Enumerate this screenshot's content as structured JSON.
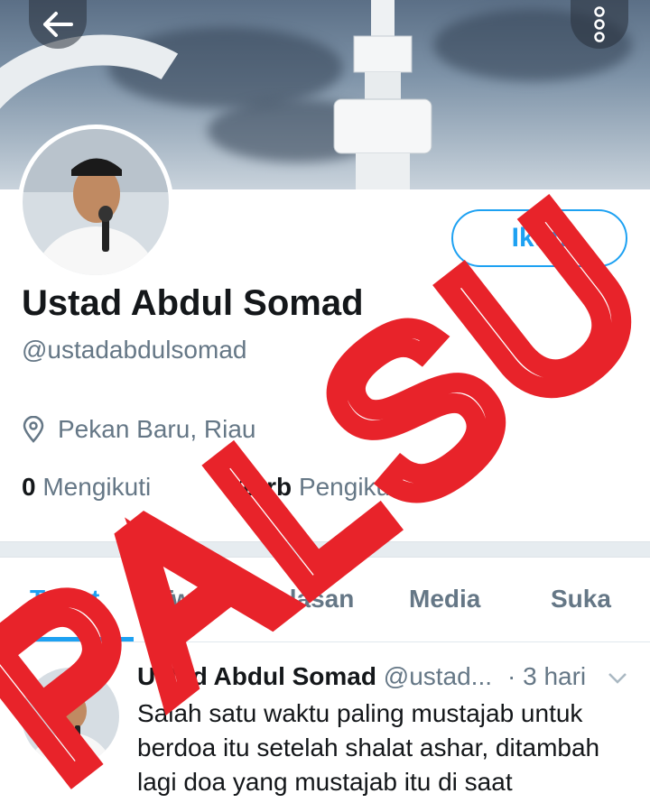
{
  "header": {
    "back_icon": "arrow-left-icon",
    "more_icon": "vertical-dots-icon"
  },
  "profile": {
    "follow_label": "Ikuti",
    "name": "Ustad Abdul Somad",
    "handle": "@ustadabdulsomad",
    "location_icon": "map-pin-icon",
    "location": "Pekan Baru, Riau",
    "following_count": "0",
    "following_label": "Mengikuti",
    "followers_count": "10rb",
    "followers_label": "Pengikut"
  },
  "tabs": [
    {
      "label": "Tweet",
      "active": true
    },
    {
      "label": "Tweet & balasan",
      "active": false
    },
    {
      "label": "Media",
      "active": false
    },
    {
      "label": "Suka",
      "active": false
    }
  ],
  "tweet": {
    "author": "Ustad Abdul Somad",
    "handle": "@ustad...",
    "time": "· 3 hari",
    "lines": [
      "Salah satu waktu paling mustajab untuk",
      "berdoa itu setelah shalat ashar, ditambah",
      "lagi doa yang mustajab itu di saat"
    ]
  },
  "overlay_stamp": "PALSU",
  "colors": {
    "accent": "#1da1f2",
    "secondary_text": "#657786",
    "stamp": "#e8232a"
  }
}
